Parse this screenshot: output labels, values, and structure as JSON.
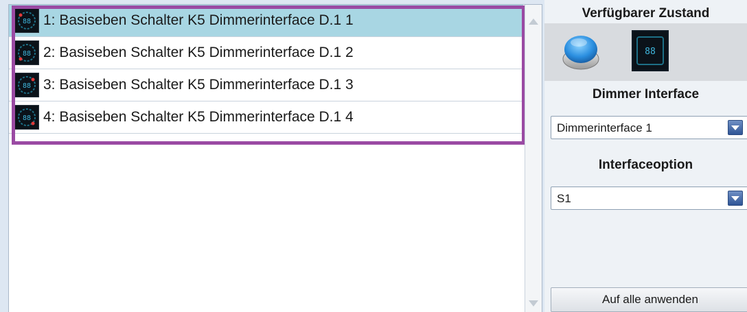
{
  "list": {
    "items": [
      {
        "label": "1: Basiseben Schalter K5 Dimmerinterface D.1 1",
        "selected": true
      },
      {
        "label": "2: Basiseben Schalter K5 Dimmerinterface D.1 2",
        "selected": false
      },
      {
        "label": "3: Basiseben Schalter K5 Dimmerinterface D.1 3",
        "selected": false
      },
      {
        "label": "4: Basiseben Schalter K5 Dimmerinterface D.1 4",
        "selected": false
      }
    ],
    "thumbnail_icon": "dimmer-display-icon",
    "highlight_color": "#9a4aa3",
    "selected_color": "#a8d6e3"
  },
  "right_panel": {
    "state_title": "Verfügbarer Zustand",
    "state_icons": [
      "blue-push-button-icon",
      "dimmer-display-icon"
    ],
    "dimmer_title": "Dimmer Interface",
    "dimmer_select_value": "Dimmerinterface 1",
    "option_title": "Interfaceoption",
    "option_select_value": "S1",
    "apply_button_label": "Auf alle anwenden"
  },
  "display_digits": "88"
}
